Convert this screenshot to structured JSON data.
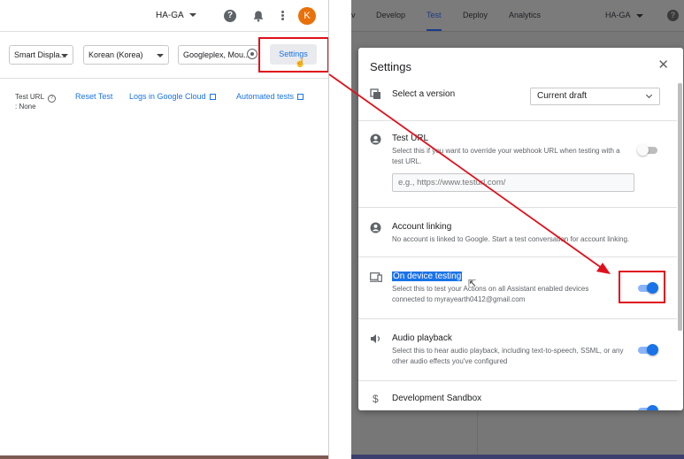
{
  "left": {
    "project": "HA-GA",
    "avatar_initial": "K",
    "help_glyph": "?",
    "surface_select": "Smart Displa...",
    "language_select": "Korean (Korea)",
    "location_select": "Googleplex, Mou...",
    "settings_label": "Settings",
    "test_url_label": "Test URL",
    "test_url_value": ": None",
    "reset_test": "Reset Test",
    "logs_link": "Logs in Google Cloud",
    "automated_tests": "Automated tests"
  },
  "right": {
    "nav_tabs": [
      "v",
      "Develop",
      "Test",
      "Deploy",
      "Analytics"
    ],
    "active_tab": "Test",
    "project": "HA-GA",
    "help_glyph": "?"
  },
  "modal": {
    "title": "Settings",
    "close_glyph": "✕",
    "version": {
      "label": "Select a version",
      "selected": "Current draft"
    },
    "test_url": {
      "label": "Test URL",
      "desc": "Select this if you want to override your webhook URL when testing with a test URL.",
      "placeholder": "e.g., https://www.testurl.com/",
      "enabled": false
    },
    "account_linking": {
      "label": "Account linking",
      "desc": "No account is linked to Google. Start a test conversation for account linking."
    },
    "on_device": {
      "label": "On device testing",
      "desc": "Select this to test your Actions on all Assistant enabled devices connected to myrayearth0412@gmail.com",
      "enabled": true
    },
    "audio_playback": {
      "label": "Audio playback",
      "desc": "Select this to hear audio playback, including text-to-speech, SSML, or any other audio effects you've configured",
      "enabled": true
    },
    "dev_sandbox": {
      "label": "Development Sandbox",
      "enabled": true
    }
  },
  "colors": {
    "accent": "#1a73e8",
    "annotation_red": "#e0101b",
    "avatar": "#e8710a"
  }
}
